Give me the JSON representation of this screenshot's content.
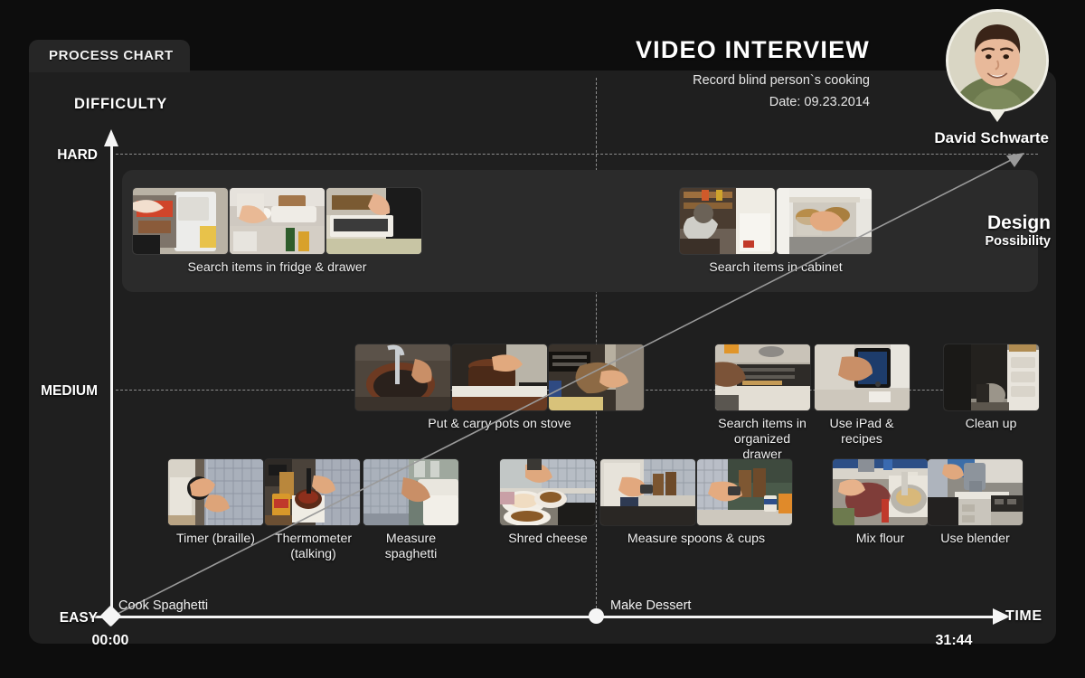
{
  "tab": {
    "label": "PROCESS CHART"
  },
  "header": {
    "title": "VIDEO INTERVIEW",
    "subtitle": "Record blind person`s cooking",
    "date": "Date: 09.23.2014",
    "person_name": "David Schwarte"
  },
  "axes": {
    "y_title": "DIFFICULTY",
    "x_title": "TIME",
    "y_ticks": [
      "HARD",
      "MEDIUM",
      "EASY"
    ],
    "time_start": "00:00",
    "time_end": "31:44"
  },
  "milestones": [
    {
      "label": "Cook Spaghetti",
      "marker": "diamond",
      "time": "00:00"
    },
    {
      "label": "Make Dessert",
      "marker": "circle",
      "time": "mid"
    }
  ],
  "annotation": {
    "design_line1": "Design",
    "design_line2": "Possibility"
  },
  "chart_data": {
    "type": "scatter",
    "title": "VIDEO INTERVIEW",
    "subtitle": "Record blind person`s cooking",
    "xlabel": "TIME",
    "ylabel": "DIFFICULTY",
    "xlim": [
      "00:00",
      "31:44"
    ],
    "y_categories": [
      "EASY",
      "MEDIUM",
      "HARD"
    ],
    "grid": true,
    "legend": "none",
    "annotations": [
      "Design Possibility",
      "Cook Spaghetti",
      "Make Dessert"
    ],
    "tasks": [
      {
        "label": "Search items in fridge & drawer",
        "difficulty": "HARD",
        "photos": 3,
        "x_pct": 6
      },
      {
        "label": "Search items in cabinet",
        "difficulty": "HARD",
        "photos": 2,
        "x_pct": 66
      },
      {
        "label": "Put & carry pots on stove",
        "difficulty": "MEDIUM",
        "photos": 3,
        "x_pct": 31
      },
      {
        "label": "Search items in organized drawer",
        "difficulty": "MEDIUM",
        "photos": 1,
        "x_pct": 72
      },
      {
        "label": "Use iPad & recipes",
        "difficulty": "MEDIUM",
        "photos": 1,
        "x_pct": 83
      },
      {
        "label": "Clean up",
        "difficulty": "MEDIUM",
        "photos": 1,
        "x_pct": 96
      },
      {
        "label": "Timer (braille)",
        "difficulty": "EASY",
        "photos": 1,
        "x_pct": 9
      },
      {
        "label": "Thermometer (talking)",
        "difficulty": "EASY",
        "photos": 1,
        "x_pct": 20
      },
      {
        "label": "Measure spaghetti",
        "difficulty": "EASY",
        "photos": 1,
        "x_pct": 32
      },
      {
        "label": "Shred cheese",
        "difficulty": "EASY",
        "photos": 1,
        "x_pct": 46
      },
      {
        "label": "Measure spoons & cups",
        "difficulty": "EASY",
        "photos": 2,
        "x_pct": 62
      },
      {
        "label": "Mix flour",
        "difficulty": "EASY",
        "photos": 1,
        "x_pct": 86
      },
      {
        "label": "Use blender",
        "difficulty": "EASY",
        "photos": 1,
        "x_pct": 95
      }
    ]
  },
  "groups": {
    "fridge": {
      "caption": "Search items in fridge & drawer"
    },
    "cabinet": {
      "caption": "Search items in cabinet"
    },
    "pots": {
      "caption": "Put & carry pots on stove"
    },
    "drawer": {
      "caption": "Search items in organized drawer"
    },
    "ipad": {
      "caption": "Use iPad & recipes"
    },
    "cleanup": {
      "caption": "Clean up"
    },
    "timer": {
      "caption": "Timer (braille)"
    },
    "thermo": {
      "caption": "Thermometer (talking)"
    },
    "spaghetti": {
      "caption": "Measure spaghetti"
    },
    "cheese": {
      "caption": "Shred cheese"
    },
    "spoons": {
      "caption": "Measure spoons & cups"
    },
    "flour": {
      "caption": "Mix flour"
    },
    "blender": {
      "caption": "Use blender"
    }
  },
  "colors": {
    "page_bg": "#0d0d0d",
    "card_bg": "#1f1f1f",
    "tab_bg": "#262626",
    "panel_bg": "#2b2b2b",
    "axis": "#f5f5f5",
    "grid": "#8c8c8c",
    "text": "#f0f0f0"
  }
}
